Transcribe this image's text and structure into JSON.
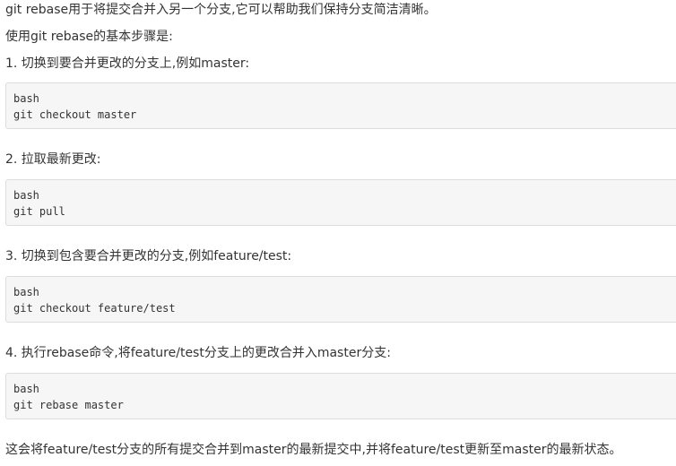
{
  "intro": "git rebase用于将提交合并入另一个分支,它可以帮助我们保持分支简洁清晰。",
  "steps_heading": "使用git rebase的基本步骤是:",
  "steps": [
    {
      "text": "1. 切换到要合并更改的分支上,例如master:",
      "code": {
        "lang": "bash",
        "command": "git checkout master"
      }
    },
    {
      "text": "2. 拉取最新更改:",
      "code": {
        "lang": "bash",
        "command": "git pull"
      }
    },
    {
      "text": "3. 切换到包含要合并更改的分支,例如feature/test:",
      "code": {
        "lang": "bash",
        "command": "git checkout feature/test"
      }
    },
    {
      "text": "4. 执行rebase命令,将feature/test分支上的更改合并入master分支:",
      "code": {
        "lang": "bash",
        "command": "git rebase master"
      }
    }
  ],
  "conclusion": "这会将feature/test分支的所有提交合并到master的最新提交中,并将feature/test更新至master的最新状态。"
}
